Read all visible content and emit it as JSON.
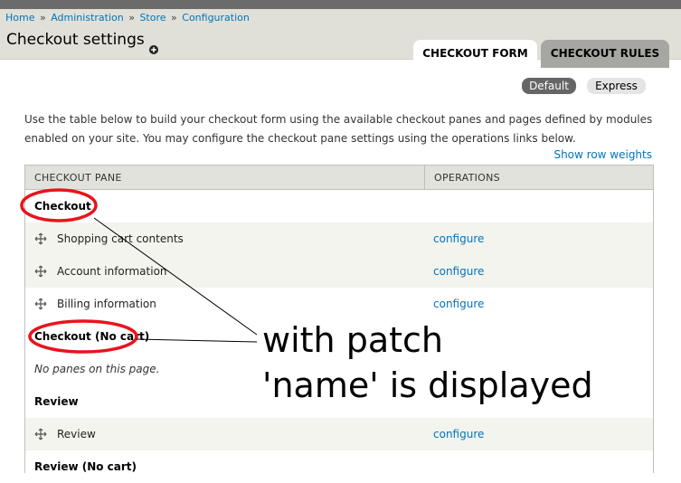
{
  "breadcrumb": {
    "items": [
      "Home",
      "Administration",
      "Store",
      "Configuration"
    ],
    "separator": "»"
  },
  "page": {
    "title": "Checkout settings"
  },
  "tabs": [
    {
      "label": "CHECKOUT FORM",
      "active": true
    },
    {
      "label": "CHECKOUT RULES",
      "active": false
    }
  ],
  "mode_switch": {
    "default_label": "Default",
    "express_label": "Express"
  },
  "description": "Use the table below to build your checkout form using the available checkout panes and pages defined by modules enabled on your site. You may configure the checkout pane settings using the operations links below.",
  "show_row_weights": "Show row weights",
  "table": {
    "headers": [
      "CHECKOUT PANE",
      "OPERATIONS"
    ],
    "rows": [
      {
        "type": "region",
        "label": "Checkout"
      },
      {
        "type": "pane",
        "label": "Shopping cart contents",
        "op": "configure"
      },
      {
        "type": "pane",
        "label": "Account information",
        "op": "configure"
      },
      {
        "type": "pane",
        "label": "Billing information",
        "op": "configure"
      },
      {
        "type": "region",
        "label": "Checkout (No cart)"
      },
      {
        "type": "empty",
        "label": "No panes on this page."
      },
      {
        "type": "region",
        "label": "Review"
      },
      {
        "type": "pane",
        "label": "Review",
        "op": "configure"
      },
      {
        "type": "region",
        "label": "Review (No cart)"
      }
    ]
  },
  "annotation": {
    "line1": "with patch",
    "line2": "'name' is displayed",
    "color": "#e8141c"
  },
  "colors": {
    "link": "#0074bd",
    "header_bg": "#e0e0d8",
    "inactive_tab": "#a6a7a2"
  }
}
